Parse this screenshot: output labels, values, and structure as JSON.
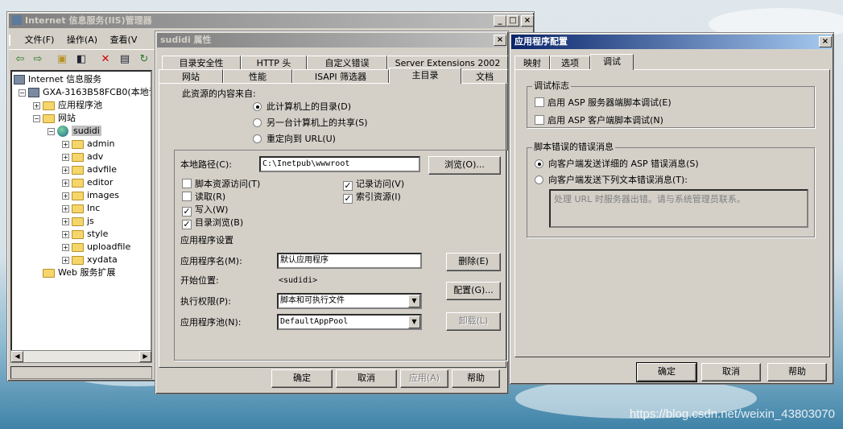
{
  "iis_window": {
    "title": "Internet 信息服务(IIS)管理器",
    "controls": {
      "minimize": "_",
      "maximize": "□",
      "close": "×"
    },
    "menu": [
      "文件(F)",
      "操作(A)",
      "查看(V"
    ],
    "tree": {
      "root": "Internet 信息服务",
      "server": "GXA-3163B58FCB0(本地计",
      "app_pools": "应用程序池",
      "websites": "网站",
      "site": "sudidi",
      "folders": [
        "admin",
        "adv",
        "advfile",
        "editor",
        "images",
        "Inc",
        "js",
        "style",
        "uploadfile",
        "xydata"
      ],
      "web_ext": "Web 服务扩展"
    }
  },
  "props_window": {
    "title": "sudidi 属性",
    "tabs_row1": [
      "目录安全性",
      "HTTP 头",
      "自定义错误",
      "Server Extensions 2002"
    ],
    "tabs_row2": [
      "网站",
      "性能",
      "ISAPI 筛选器",
      "主目录",
      "文档"
    ],
    "source_label": "此资源的内容来自:",
    "source_options": [
      "此计算机上的目录(D)",
      "另一台计算机上的共享(S)",
      "重定向到 URL(U)"
    ],
    "local_path_label": "本地路径(C):",
    "local_path_value": "C:\\Inetpub\\wwwroot",
    "browse_button": "浏览(O)...",
    "checks_left": [
      {
        "label": "脚本资源访问(T)",
        "checked": false
      },
      {
        "label": "读取(R)",
        "checked": false
      },
      {
        "label": "写入(W)",
        "checked": true
      },
      {
        "label": "目录浏览(B)",
        "checked": true
      }
    ],
    "checks_right": [
      {
        "label": "记录访问(V)",
        "checked": true
      },
      {
        "label": "索引资源(I)",
        "checked": true
      }
    ],
    "app_settings_label": "应用程序设置",
    "app_name_label": "应用程序名(M):",
    "app_name_value": "默认应用程序",
    "remove_button": "删除(E)",
    "start_label": "开始位置:",
    "start_value": "<sudidi>",
    "config_button": "配置(G)...",
    "exec_label": "执行权限(P):",
    "exec_value": "脚本和可执行文件",
    "pool_label": "应用程序池(N):",
    "pool_value": "DefaultAppPool",
    "unload_button": "卸载(L)",
    "ok_button": "确定",
    "cancel_button": "取消",
    "apply_button": "应用(A)",
    "help_button": "帮助"
  },
  "app_config_window": {
    "title": "应用程序配置",
    "close": "×",
    "tabs": [
      "映射",
      "选项",
      "调试"
    ],
    "debug_group": "调试标志",
    "debug_checks": [
      "启用 ASP 服务器端脚本调试(E)",
      "启用 ASP 客户端脚本调试(N)"
    ],
    "error_group": "脚本错误的错误消息",
    "error_options": [
      "向客户端发送详细的 ASP 错误消息(S)",
      "向客户端发送下列文本错误消息(T):"
    ],
    "error_text": "处理 URL 时服务器出错。请与系统管理员联系。",
    "ok_button": "确定",
    "cancel_button": "取消",
    "help_button": "帮助"
  },
  "watermark": "https://blog.csdn.net/weixin_43803070"
}
